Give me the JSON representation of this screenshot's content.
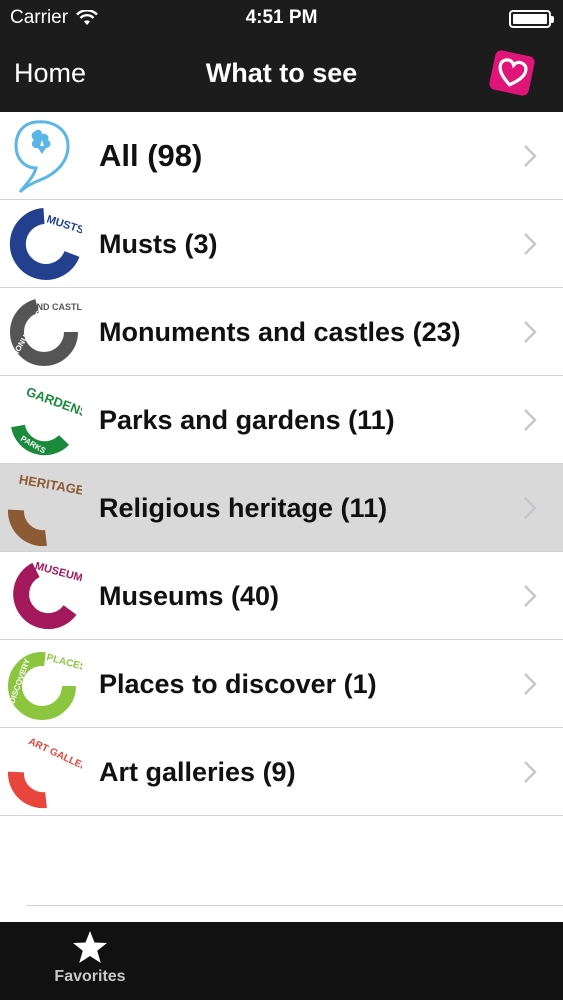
{
  "status_bar": {
    "carrier": "Carrier",
    "time": "4:51 PM",
    "wifi_icon": "wifi-icon",
    "battery_icon": "battery-icon"
  },
  "nav": {
    "back_label": "Home",
    "title": "What to see",
    "favorites_logo_icon": "heart-logo-icon",
    "favorites_logo_color": "#e0157a"
  },
  "categories": [
    {
      "label": "All (98)",
      "icon": "all-category-icon",
      "color": "#5ab6e6"
    },
    {
      "label": "Musts (3)",
      "icon": "musts-category-icon",
      "color": "#23408f",
      "icon_text": "MUSTS"
    },
    {
      "label": "Monuments and castles (23)",
      "icon": "monuments-category-icon",
      "color": "#555555",
      "icon_text": "MONUMENTS AND CASTLES"
    },
    {
      "label": "Parks and gardens (11)",
      "icon": "parks-category-icon",
      "color": "#1a8a3c",
      "icon_text": "PARKS GARDENS"
    },
    {
      "label": "Religious heritage (11)",
      "icon": "heritage-category-icon",
      "color": "#8c5a33",
      "icon_text": "HERITAGE"
    },
    {
      "label": "Museums (40)",
      "icon": "museums-category-icon",
      "color": "#a3195b",
      "icon_text": "MUSEUMS"
    },
    {
      "label": "Places to discover (1)",
      "icon": "places-category-icon",
      "color": "#8cc63f",
      "icon_text": "DISCOVERY PLACES"
    },
    {
      "label": "Art galleries (9)",
      "icon": "art-galleries-category-icon",
      "color": "#e8453c",
      "icon_text": "ART GALLERIES"
    }
  ],
  "selected_index": 4,
  "tab_bar": {
    "favorites_label": "Favorites",
    "favorites_icon": "star-icon"
  }
}
